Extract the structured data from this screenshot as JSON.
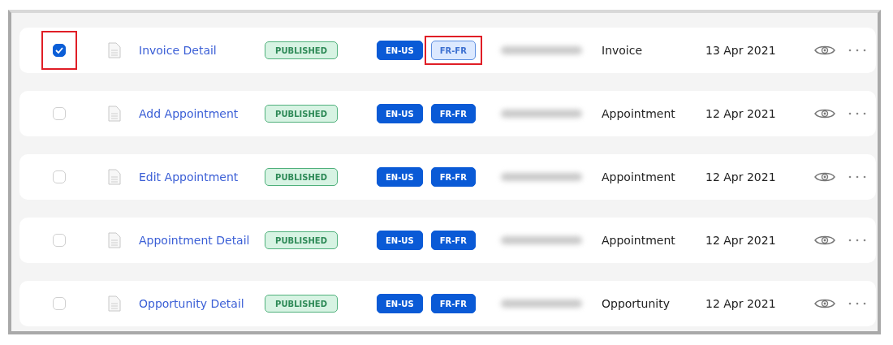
{
  "rows": [
    {
      "checked": true,
      "checkbox_highlighted": true,
      "name": "Invoice Detail",
      "status": "PUBLISHED",
      "locales": [
        {
          "label": "EN-US",
          "filled": true,
          "highlighted": false
        },
        {
          "label": "FR-FR",
          "filled": false,
          "highlighted": true
        }
      ],
      "author_blurred": true,
      "category": "Invoice",
      "date": "13 Apr 2021"
    },
    {
      "checked": false,
      "checkbox_highlighted": false,
      "name": "Add Appointment",
      "status": "PUBLISHED",
      "locales": [
        {
          "label": "EN-US",
          "filled": true,
          "highlighted": false
        },
        {
          "label": "FR-FR",
          "filled": true,
          "highlighted": false
        }
      ],
      "author_blurred": true,
      "category": "Appointment",
      "date": "12 Apr 2021"
    },
    {
      "checked": false,
      "checkbox_highlighted": false,
      "name": "Edit Appointment",
      "status": "PUBLISHED",
      "locales": [
        {
          "label": "EN-US",
          "filled": true,
          "highlighted": false
        },
        {
          "label": "FR-FR",
          "filled": true,
          "highlighted": false
        }
      ],
      "author_blurred": true,
      "category": "Appointment",
      "date": "12 Apr 2021"
    },
    {
      "checked": false,
      "checkbox_highlighted": false,
      "name": "Appointment Detail",
      "status": "PUBLISHED",
      "locales": [
        {
          "label": "EN-US",
          "filled": true,
          "highlighted": false
        },
        {
          "label": "FR-FR",
          "filled": true,
          "highlighted": false
        }
      ],
      "author_blurred": true,
      "category": "Appointment",
      "date": "12 Apr 2021"
    },
    {
      "checked": false,
      "checkbox_highlighted": false,
      "name": "Opportunity Detail",
      "status": "PUBLISHED",
      "locales": [
        {
          "label": "EN-US",
          "filled": true,
          "highlighted": false
        },
        {
          "label": "FR-FR",
          "filled": true,
          "highlighted": false
        }
      ],
      "author_blurred": true,
      "category": "Opportunity",
      "date": "12 Apr 2021"
    }
  ]
}
